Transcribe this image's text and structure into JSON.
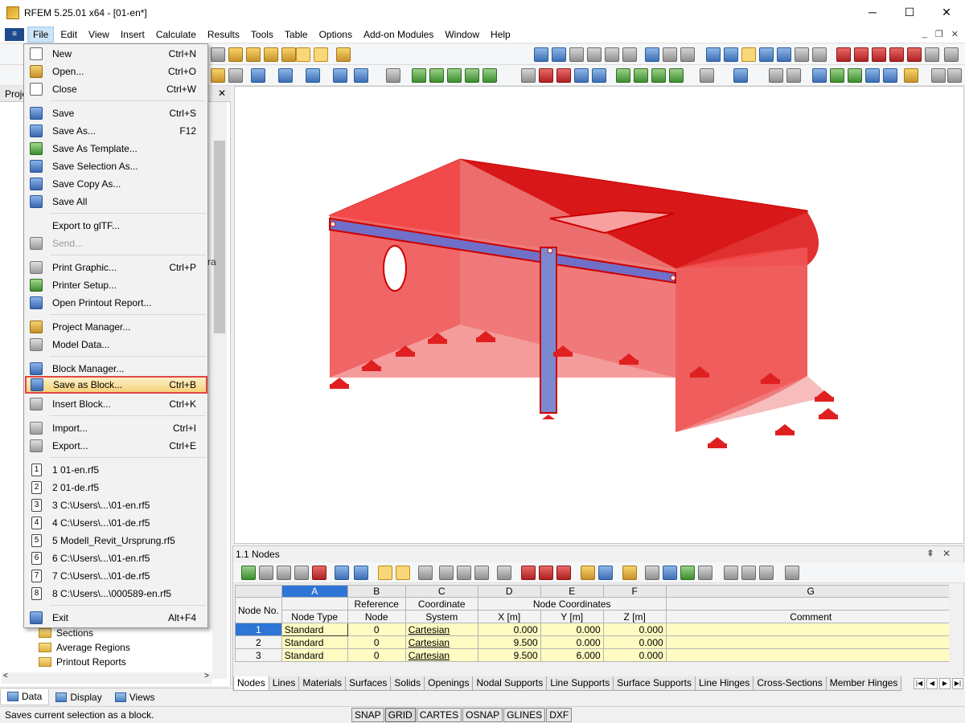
{
  "window": {
    "title": "RFEM 5.25.01 x64 - [01-en*]",
    "minimize": "─",
    "maximize": "☐",
    "close": "✕"
  },
  "menubar": {
    "items": [
      "File",
      "Edit",
      "View",
      "Insert",
      "Calculate",
      "Results",
      "Tools",
      "Table",
      "Options",
      "Add-on Modules",
      "Window",
      "Help"
    ]
  },
  "left_panel": {
    "header": "Proje",
    "tree_items": [
      "Sections",
      "Average Regions",
      "Printout Reports"
    ],
    "tabs": [
      "Data",
      "Display",
      "Views"
    ]
  },
  "file_menu": {
    "items": [
      {
        "label": "New",
        "shortcut": "Ctrl+N",
        "icon": "new-document-icon"
      },
      {
        "label": "Open...",
        "shortcut": "Ctrl+O",
        "icon": "open-folder-icon"
      },
      {
        "label": "Close",
        "shortcut": "Ctrl+W",
        "icon": "close-document-icon"
      },
      {
        "label": "Save",
        "shortcut": "Ctrl+S",
        "icon": "save-icon"
      },
      {
        "label": "Save As...",
        "shortcut": "F12",
        "icon": "save-as-icon"
      },
      {
        "label": "Save As Template...",
        "shortcut": "",
        "icon": "save-template-icon"
      },
      {
        "label": "Save Selection As...",
        "shortcut": "",
        "icon": "save-selection-icon"
      },
      {
        "label": "Save Copy As...",
        "shortcut": "",
        "icon": "save-copy-icon"
      },
      {
        "label": "Save All",
        "shortcut": "",
        "icon": "save-all-icon"
      },
      {
        "label": "Export to glTF...",
        "shortcut": "",
        "icon": "export-gltf-icon"
      },
      {
        "label": "Send...",
        "shortcut": "",
        "icon": "send-icon",
        "disabled": true
      },
      {
        "label": "Print Graphic...",
        "shortcut": "Ctrl+P",
        "icon": "print-graphic-icon"
      },
      {
        "label": "Printer Setup...",
        "shortcut": "",
        "icon": "printer-setup-icon"
      },
      {
        "label": "Open Printout Report...",
        "shortcut": "",
        "icon": "printout-report-icon"
      },
      {
        "label": "Project Manager...",
        "shortcut": "",
        "icon": "project-manager-icon"
      },
      {
        "label": "Model Data...",
        "shortcut": "",
        "icon": "model-data-icon"
      },
      {
        "label": "Block Manager...",
        "shortcut": "",
        "icon": "block-manager-icon"
      },
      {
        "label": "Save as Block...",
        "shortcut": "Ctrl+B",
        "icon": "save-block-icon",
        "highlighted": true
      },
      {
        "label": "Insert Block...",
        "shortcut": "Ctrl+K",
        "icon": "insert-block-icon"
      },
      {
        "label": "Import...",
        "shortcut": "Ctrl+I",
        "icon": "import-icon"
      },
      {
        "label": "Export...",
        "shortcut": "Ctrl+E",
        "icon": "export-icon"
      },
      {
        "label": "1 01-en.rf5",
        "shortcut": "",
        "icon": "recent-file-1-icon",
        "num": "1"
      },
      {
        "label": "2 01-de.rf5",
        "shortcut": "",
        "icon": "recent-file-2-icon",
        "num": "2"
      },
      {
        "label": "3 C:\\Users\\...\\01-en.rf5",
        "shortcut": "",
        "icon": "recent-file-3-icon",
        "num": "3"
      },
      {
        "label": "4 C:\\Users\\...\\01-de.rf5",
        "shortcut": "",
        "icon": "recent-file-4-icon",
        "num": "4"
      },
      {
        "label": "5 Modell_Revit_Ursprung.rf5",
        "shortcut": "",
        "icon": "recent-file-5-icon",
        "num": "5"
      },
      {
        "label": "6 C:\\Users\\...\\01-en.rf5",
        "shortcut": "",
        "icon": "recent-file-6-icon",
        "num": "6"
      },
      {
        "label": "7 C:\\Users\\...\\01-de.rf5",
        "shortcut": "",
        "icon": "recent-file-7-icon",
        "num": "7"
      },
      {
        "label": "8 C:\\Users\\...\\000589-en.rf5",
        "shortcut": "",
        "icon": "recent-file-8-icon",
        "num": "8"
      },
      {
        "label": "Exit",
        "shortcut": "Alt+F4",
        "icon": "exit-icon"
      }
    ]
  },
  "table_panel": {
    "title": "1.1 Nodes",
    "col_letters": [
      "A",
      "B",
      "C",
      "D",
      "E",
      "F",
      "G"
    ],
    "headers": {
      "node_no": "Node No.",
      "node_type": "Node Type",
      "reference": "Reference",
      "reference2": "Node",
      "coord": "Coordinate",
      "coord2": "System",
      "node_coords": "Node Coordinates",
      "x": "X [m]",
      "y": "Y [m]",
      "z": "Z [m]",
      "comment": "Comment"
    },
    "rows": [
      {
        "no": "1",
        "type": "Standard",
        "ref": "0",
        "sys": "Cartesian",
        "x": "0.000",
        "y": "0.000",
        "z": "0.000"
      },
      {
        "no": "2",
        "type": "Standard",
        "ref": "0",
        "sys": "Cartesian",
        "x": "9.500",
        "y": "0.000",
        "z": "0.000"
      },
      {
        "no": "3",
        "type": "Standard",
        "ref": "0",
        "sys": "Cartesian",
        "x": "9.500",
        "y": "6.000",
        "z": "0.000"
      }
    ],
    "sheet_tabs": [
      "Nodes",
      "Lines",
      "Materials",
      "Surfaces",
      "Solids",
      "Openings",
      "Nodal Supports",
      "Line Supports",
      "Surface Supports",
      "Line Hinges",
      "Cross-Sections",
      "Member Hinges"
    ]
  },
  "status": {
    "message": "Saves current selection as a block.",
    "toggles": [
      "SNAP",
      "GRID",
      "CARTES",
      "OSNAP",
      "GLINES",
      "DXF"
    ]
  },
  "colors": {
    "highlight_border": "#e24545",
    "model_red": "#e01818",
    "selection_blue": "#2e75d6"
  }
}
